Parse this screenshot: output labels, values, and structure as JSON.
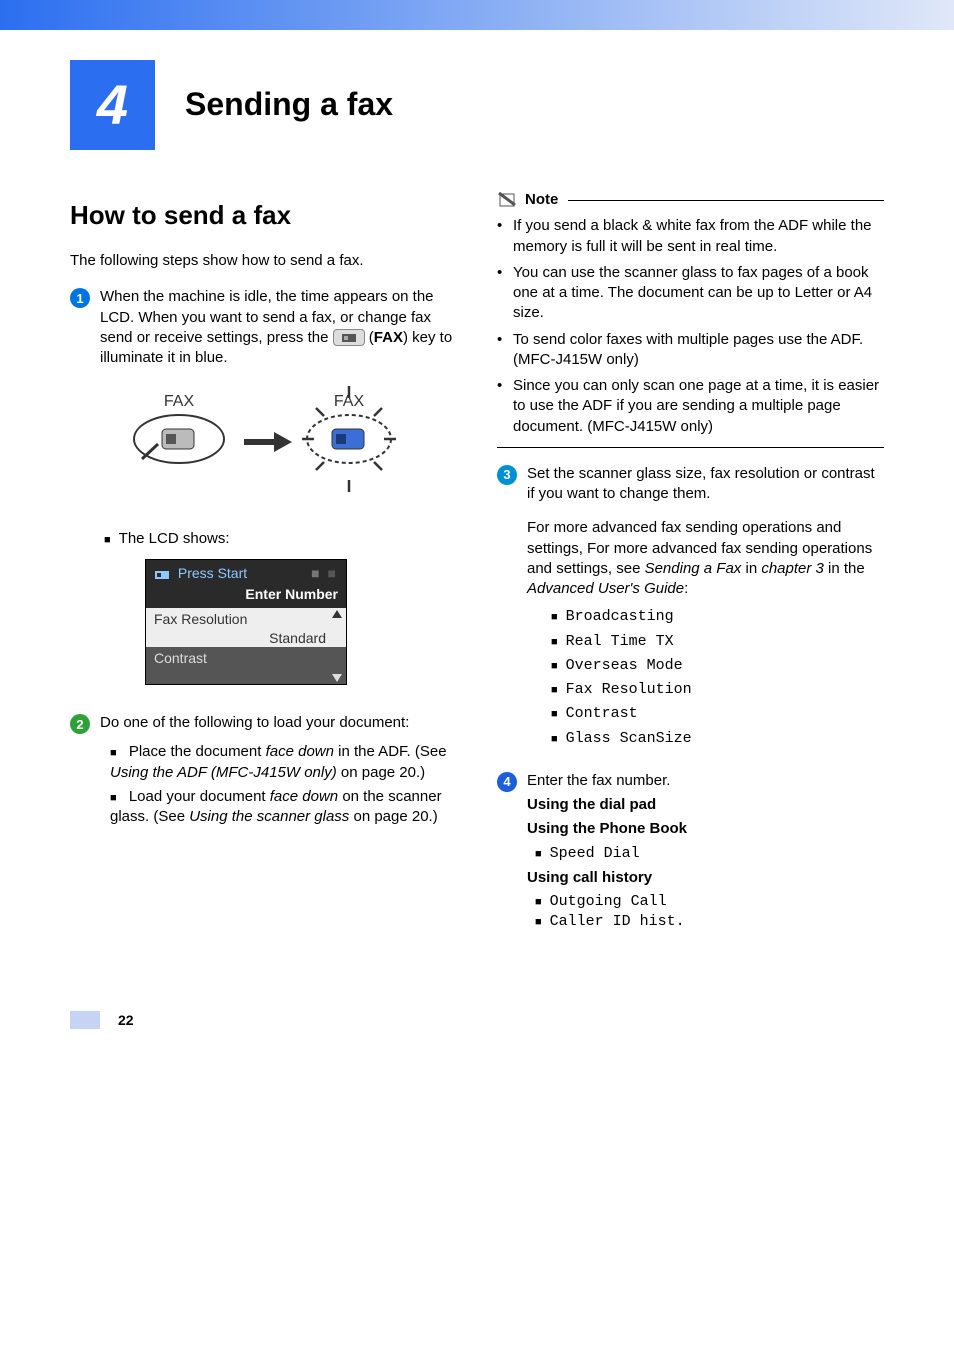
{
  "chapter": {
    "number": "4",
    "title": "Sending a fax"
  },
  "section": {
    "title": "How to send a fax",
    "intro": "The following steps show how to send a fax."
  },
  "step1": {
    "num": "1",
    "text_a": "When the machine is idle, the time appears on the LCD. When you want to send a fax, or change fax send or receive settings, press the ",
    "text_b": " (",
    "fax_label": "FAX",
    "text_c": ") key to illuminate it in blue.",
    "diagram_label": "FAX",
    "lcd_intro": "The LCD shows:",
    "lcd": {
      "press_start": "Press Start",
      "enter_number": "Enter Number",
      "row1": "Fax Resolution",
      "row1_val": "Standard",
      "row2": "Contrast"
    }
  },
  "step2": {
    "num": "2",
    "text": "Do one of the following to load your document:",
    "b1_a": "Place the document ",
    "b1_i": "face down",
    "b1_b": " in the ADF. (See ",
    "b1_i2": "Using the ADF (MFC-J415W only)",
    "b1_c": " on page 20.)",
    "b2_a": "Load your document ",
    "b2_i": "face down",
    "b2_b": " on the scanner glass. (See ",
    "b2_i2": "Using the scanner glass",
    "b2_c": " on page 20.)"
  },
  "note": {
    "label": "Note",
    "n1": "If you send a black & white fax from the ADF while the memory is full it will be sent in real time.",
    "n2": "You can use the scanner glass to fax pages of a book one at a time. The document can be up to Letter or A4 size.",
    "n3": "To send color faxes with multiple pages use the ADF. (MFC-J415W only)",
    "n4": "Since you can only scan one page at a time, it is easier to use the ADF if you are sending a multiple page document. (MFC-J415W only)"
  },
  "step3": {
    "num": "3",
    "text": "Set the scanner glass size, fax resolution or contrast if you want to change them.",
    "adv_a": "For more advanced fax sending operations and settings, For more advanced fax sending operations and settings, see ",
    "adv_i1": "Sending a Fax",
    "adv_b": " in ",
    "adv_i2": "chapter 3",
    "adv_c": " in the ",
    "adv_i3": "Advanced User's Guide",
    "adv_d": ":",
    "list": {
      "l1": "Broadcasting",
      "l2": "Real Time TX",
      "l3": "Overseas Mode",
      "l4": "Fax Resolution",
      "l5": "Contrast",
      "l6": "Glass ScanSize"
    }
  },
  "step4": {
    "num": "4",
    "text": "Enter the fax number.",
    "h1": "Using the dial pad",
    "h2": "Using the Phone Book",
    "sd": "Speed Dial",
    "h3": "Using call history",
    "oc": "Outgoing Call",
    "cid": "Caller ID hist."
  },
  "page_number": "22"
}
